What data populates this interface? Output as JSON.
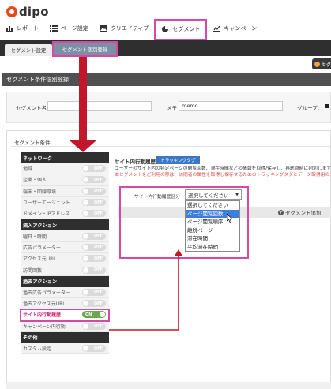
{
  "app": {
    "logo_text": "dipo"
  },
  "nav": [
    {
      "label": "レポート",
      "icon": "bar-chart-icon"
    },
    {
      "label": "ページ設定",
      "icon": "list-icon"
    },
    {
      "label": "クリエイティブ",
      "icon": "image-icon"
    },
    {
      "label": "セグメント",
      "icon": "pie-chart-icon",
      "active": true
    },
    {
      "label": "キャンペーン",
      "icon": "trend-icon"
    }
  ],
  "subnav": {
    "tab1": "セグメント設定",
    "tab2": "セグメント個別登録"
  },
  "side_button": {
    "label": "セグ"
  },
  "panel": {
    "title": "セグメント条件個別登録"
  },
  "form": {
    "segment_name_label": "セグメント名",
    "segment_name_value": "",
    "memo_label": "メモ",
    "memo_value": "memo",
    "group_label": "グループ："
  },
  "conditions": {
    "title": "セグメント条件",
    "menu": [
      {
        "type": "head",
        "label": "ネットワーク"
      },
      {
        "type": "row",
        "label": "地域",
        "state": "OFF"
      },
      {
        "type": "row",
        "label": "企業・個人",
        "state": "OFF"
      },
      {
        "type": "row",
        "label": "端末・回線環境",
        "state": "OFF"
      },
      {
        "type": "row",
        "label": "ユーザーエージェント",
        "state": "OFF"
      },
      {
        "type": "row",
        "label": "ドメイン・IPアドレス",
        "state": "OFF"
      },
      {
        "type": "head",
        "label": "流入アクション"
      },
      {
        "type": "row",
        "label": "曜日・時間",
        "state": "OFF"
      },
      {
        "type": "row",
        "label": "広告パラメーター",
        "state": "OFF"
      },
      {
        "type": "row",
        "label": "アクセス元URL",
        "state": "OFF"
      },
      {
        "type": "row",
        "label": "訪問回数",
        "state": "OFF"
      },
      {
        "type": "head",
        "label": "過去アクション"
      },
      {
        "type": "row",
        "label": "過去広告パラメーター",
        "state": "OFF"
      },
      {
        "type": "row",
        "label": "過去アクセス元URL",
        "state": "OFF"
      },
      {
        "type": "row",
        "label": "サイト内行動履歴",
        "state": "ON",
        "highlight": true
      },
      {
        "type": "row",
        "label": "キャンペーン内行動",
        "state": "OFF"
      },
      {
        "type": "head",
        "label": "その他"
      },
      {
        "type": "row",
        "label": "カスタム設定",
        "state": "OFF"
      }
    ],
    "behavior": {
      "title": "サイト内行動履歴",
      "badge": "トラッキングタグ",
      "desc": "ユーザーのサイト内の特定ページの閲覧回数、滞在時間などの情報を取得/保存し、再訪問時に判別します。",
      "note": "本セグメントをご利用の際は、訪問者の属性を取得し保存するためのトラッキングタグとデータ取得用のタグの設置が必要となります。",
      "select_label": "サイト内行動履歴区分",
      "select_value": "選択してください",
      "add_label": "セグメント追加",
      "options": [
        "選択してください",
        "ページ閲覧回数",
        "ページ閲覧順序",
        "離脱ページ",
        "滞在時間",
        "平均滞在時間"
      ],
      "selected_option_index": 1
    }
  },
  "colors": {
    "highlight": "#d64aa6",
    "arrow": "#c0182a",
    "toggle_on": "#6aa84f",
    "toggle_off": "#dadada",
    "dropdown_selected": "#3d7edc"
  }
}
